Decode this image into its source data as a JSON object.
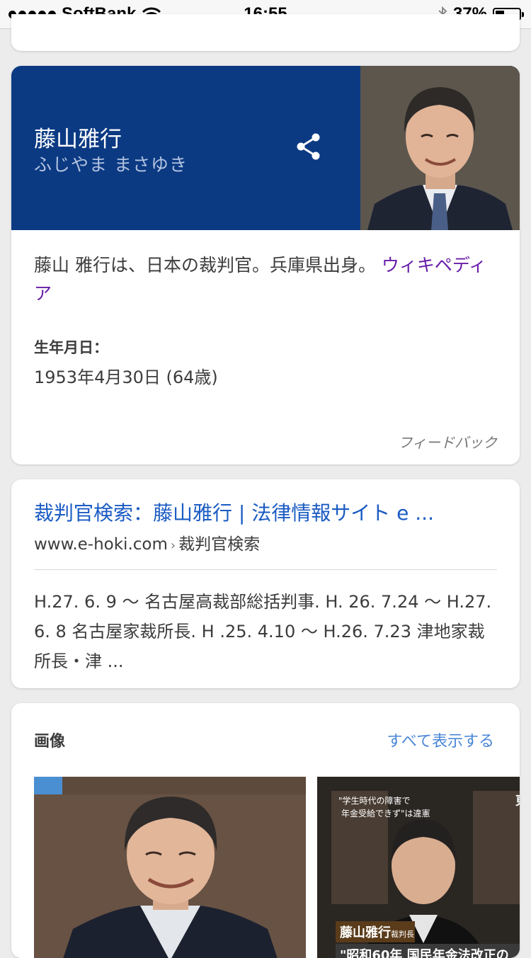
{
  "status_bar": {
    "carrier": "SoftBank",
    "time": "16:55",
    "battery": "37%",
    "battery_level": 0.37
  },
  "knowledge_panel": {
    "name": "藤山雅行",
    "reading": "ふじやま まさゆき",
    "description": "藤山 雅行は、日本の裁判官。兵庫県出身。",
    "source_link": "ウィキペディア",
    "birth_label": "生年月日：",
    "birth_value": "1953年4月30日 (64歳)",
    "feedback": "フィードバック",
    "header_color": "#0b3a83"
  },
  "result": {
    "title": "裁判官検索：藤山雅行 | 法律情報サイト e ...",
    "url_domain": "www.e-hoki.com",
    "url_sep": "›",
    "url_path": "裁判官検索",
    "snippet": "H.27. 6. 9 〜 名古屋高裁部総括判事. H. 26. 7.24 〜 H.27. 6. 8 名古屋家裁所長. H .25. 4.10 〜 H.26. 7.23 津地家裁所長・津 ...",
    "title_color": "#1a5bc3"
  },
  "images": {
    "heading": "画像",
    "show_all": "すべて表示する",
    "thumb2_caption1": "\"学生時代の障害で",
    "thumb2_caption2": "年金受給できず\"は違憲",
    "thumb2_name_label": "藤山雅行",
    "thumb2_name_suffix": "裁判長",
    "thumb2_bottom": "\"昭和60年 国民年金法改正の",
    "thumb2_corner": "東"
  }
}
